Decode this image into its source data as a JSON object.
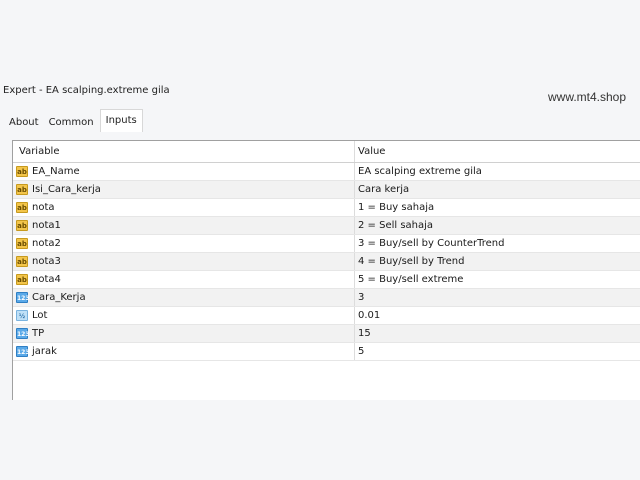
{
  "window": {
    "title": "Expert - EA scalping.extreme gila"
  },
  "watermark": "www.mt4.shop",
  "tabs": [
    {
      "label": "About"
    },
    {
      "label": "Common"
    },
    {
      "label": "Inputs"
    }
  ],
  "table": {
    "headers": {
      "variable": "Variable",
      "value": "Value"
    },
    "rows": [
      {
        "type": "text-icon",
        "variable": "EA_Name",
        "value": "EA scalping extreme gila"
      },
      {
        "type": "text-icon",
        "variable": "Isi_Cara_kerja",
        "value": "Cara kerja"
      },
      {
        "type": "text-icon",
        "variable": "nota",
        "value": "1 = Buy sahaja"
      },
      {
        "type": "text-icon",
        "variable": "nota1",
        "value": "2 = Sell sahaja"
      },
      {
        "type": "text-icon",
        "variable": "nota2",
        "value": "3 = Buy/sell by CounterTrend"
      },
      {
        "type": "text-icon",
        "variable": "nota3",
        "value": "4 = Buy/sell by Trend"
      },
      {
        "type": "text-icon",
        "variable": "nota4",
        "value": "5 = Buy/sell extreme"
      },
      {
        "type": "integer-icon",
        "variable": "Cara_Kerja",
        "value": "3"
      },
      {
        "type": "double-icon",
        "variable": "Lot",
        "value": "0.01"
      },
      {
        "type": "integer-icon",
        "variable": "TP",
        "value": "15"
      },
      {
        "type": "integer-icon",
        "variable": "jarak",
        "value": "5"
      }
    ]
  }
}
